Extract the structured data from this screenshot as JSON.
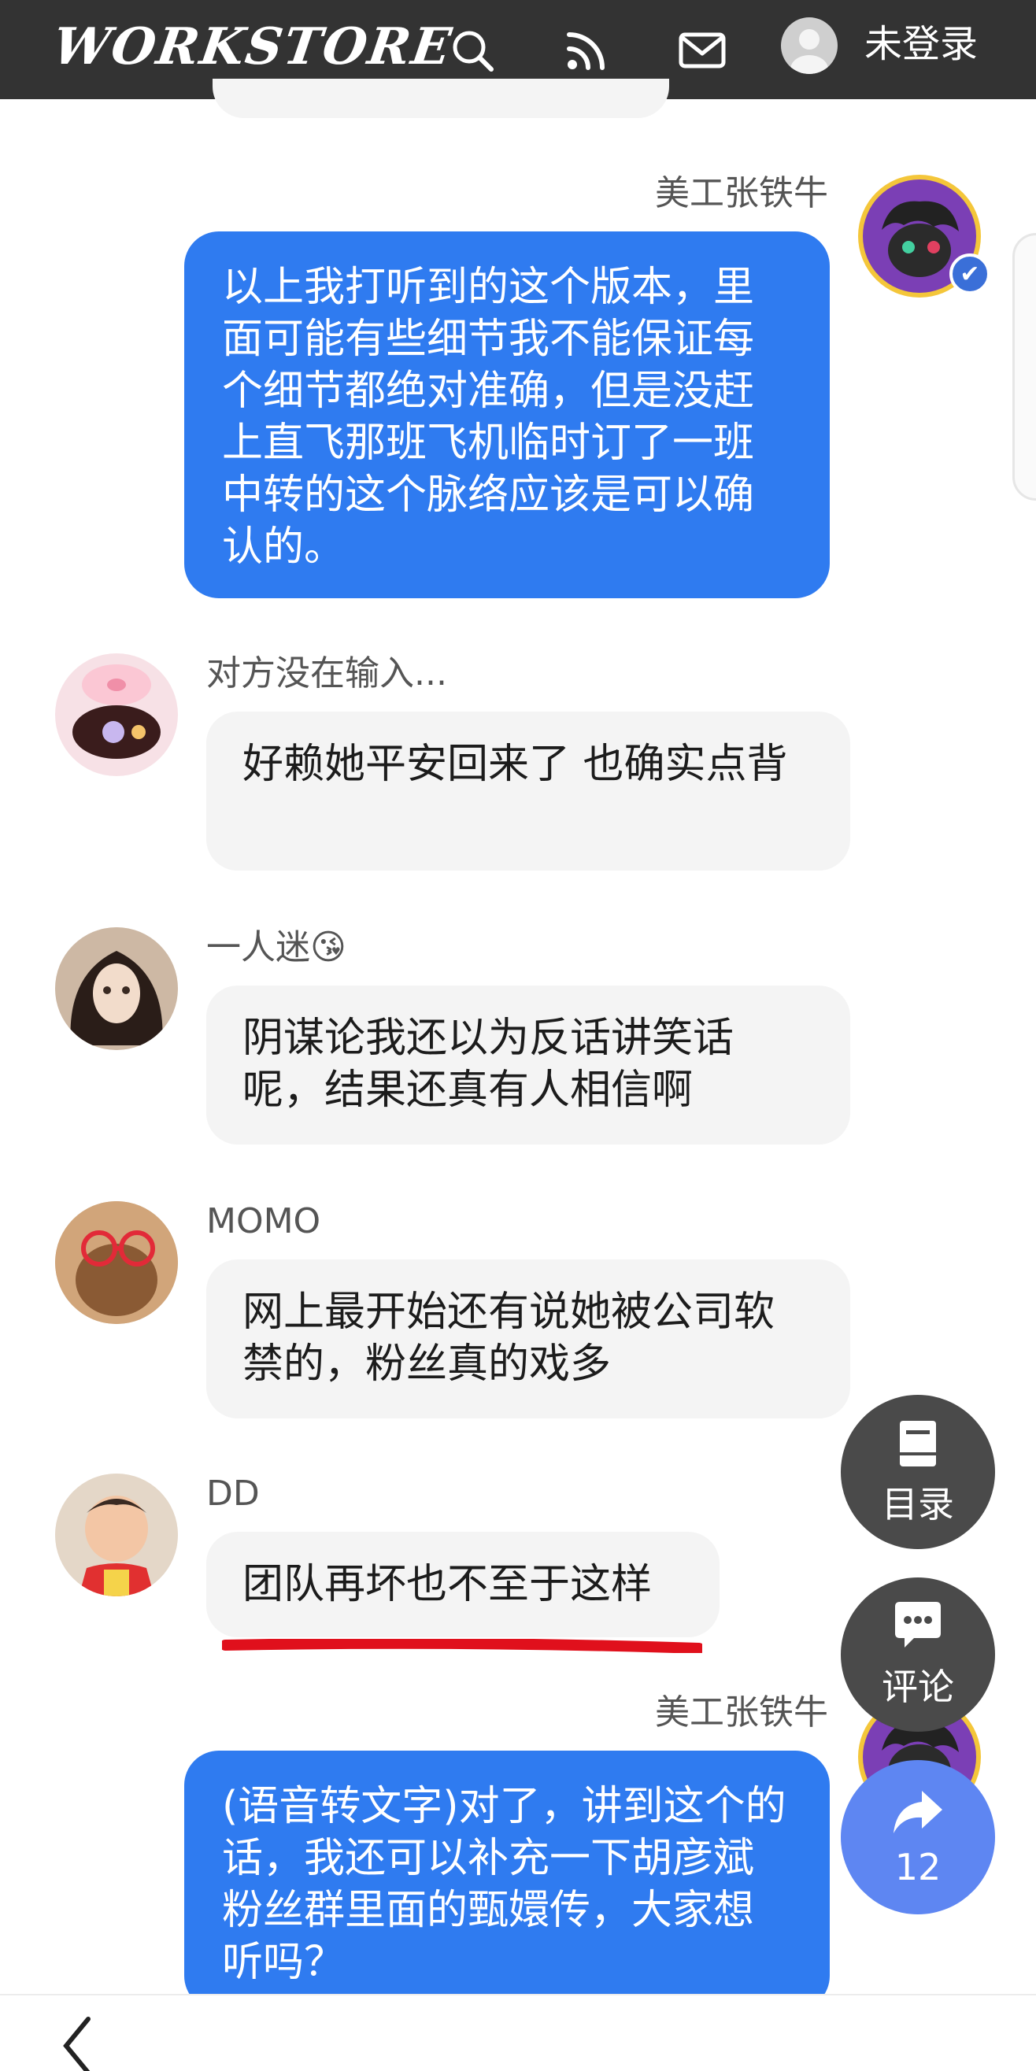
{
  "header": {
    "logo": "WORKSTORE",
    "icons": [
      "search-icon",
      "rss-icon",
      "mail-icon"
    ],
    "login_label": "未登录"
  },
  "messages": [
    {
      "sender": "美工张铁牛",
      "side": "right",
      "text": "以上我打听到的这个版本，里面可能有些细节我不能保证每个细节都绝对准确，但是没赶上直飞那班飞机临时订了一班中转的这个脉络应该是可以确认的。"
    },
    {
      "sender": "对方没在输入...",
      "side": "left",
      "text": "好赖她平安回来了 也确实点背"
    },
    {
      "sender": "一人迷😘",
      "side": "left",
      "text": "阴谋论我还以为反话讲笑话呢，结果还真有人相信啊"
    },
    {
      "sender": "MOMO",
      "side": "left",
      "text": "网上最开始还有说她被公司软禁的，粉丝真的戏多"
    },
    {
      "sender": "DD",
      "side": "left",
      "text": "团队再坏也不至于这样"
    },
    {
      "sender": "美工张铁牛",
      "side": "right",
      "text": "(语音转文字)对了，讲到这个的话，我还可以补充一下胡彦斌粉丝群里面的甄嬛传，大家想听吗？"
    }
  ],
  "fabs": {
    "toc_label": "目录",
    "comment_label": "评论",
    "share_count": "12"
  },
  "colors": {
    "topbar": "#333333",
    "my_bubble": "#2f7bf0",
    "other_bubble": "#f4f4f4",
    "fab_dark": "#4a4a4a",
    "fab_blue": "#5e86f2",
    "underline": "#e0101c"
  }
}
